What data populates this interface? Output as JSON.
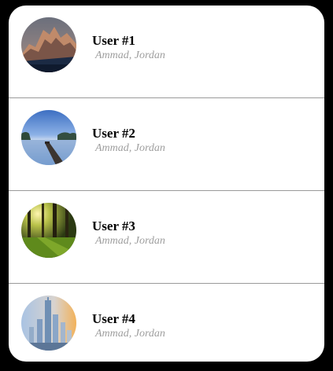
{
  "users": [
    {
      "name": "User #1",
      "subtitle": "Ammad, Jordan",
      "avatar_icon": "mountain-dusk-photo"
    },
    {
      "name": "User #2",
      "subtitle": "Ammad, Jordan",
      "avatar_icon": "lake-pier-photo"
    },
    {
      "name": "User #3",
      "subtitle": "Ammad, Jordan",
      "avatar_icon": "forest-sunlight-photo"
    },
    {
      "name": "User #4",
      "subtitle": "Ammad, Jordan",
      "avatar_icon": "city-skyline-photo"
    }
  ],
  "colors": {
    "background": "#000000",
    "card": "#ffffff",
    "divider": "#9a9a9a",
    "name_text": "#000000",
    "subtitle_text": "#9e9e9e"
  }
}
